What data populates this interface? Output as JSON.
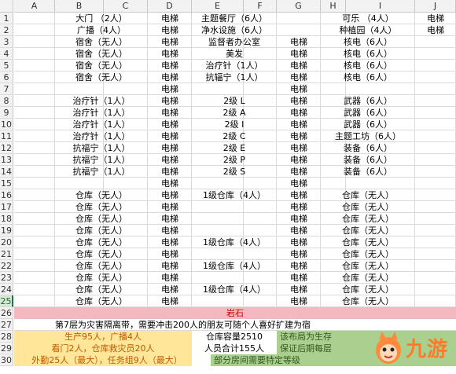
{
  "columns": [
    "A",
    "B",
    "C",
    "D",
    "E",
    "F",
    "G",
    "H",
    "I",
    "J"
  ],
  "row_numbers": [
    "1",
    "2",
    "3",
    "4",
    "5",
    "6",
    "7",
    "8",
    "9",
    "10",
    "11",
    "12",
    "13",
    "14",
    "15",
    "16",
    "17",
    "18",
    "19",
    "20",
    "21",
    "22",
    "23",
    "24",
    "25",
    "26",
    "27",
    "28",
    "29",
    "30"
  ],
  "selected_row": "25",
  "rows": [
    {
      "b": "大门  （2人）",
      "d": "电梯",
      "e": "主题餐厅（6人）",
      "g": "",
      "h": "可乐  （4人）",
      "j": "电梯"
    },
    {
      "b": "广播（4人）",
      "d": "电梯",
      "e": "净水设施（6人）",
      "g": "",
      "h": "种植园（4人）",
      "j": "电梯"
    },
    {
      "b": "宿舍（无人）",
      "d": "电梯",
      "e": "监督者办公室",
      "g": "电梯",
      "h": "核电（6人）",
      "j": ""
    },
    {
      "b": "宿舍（无人）",
      "d": "电梯",
      "e": "美发",
      "g": "电梯",
      "h": "核电（6人）",
      "j": ""
    },
    {
      "b": "宿舍（无人）",
      "d": "电梯",
      "e": "治疗针（1人）",
      "g": "电梯",
      "h": "核电（6人）",
      "j": ""
    },
    {
      "b": "宿舍（无人）",
      "d": "电梯",
      "e": "抗辐宁（1人）",
      "g": "电梯",
      "h": "核电（6人）",
      "j": ""
    },
    {
      "b": "",
      "d": "电梯",
      "e": "",
      "g": "电梯",
      "h": "",
      "j": ""
    },
    {
      "b": "治疗针（1人）",
      "d": "电梯",
      "e": "2级 L",
      "g": "电梯",
      "h": "武器（6人）",
      "j": ""
    },
    {
      "b": "治疗针（1人）",
      "d": "电梯",
      "e": "2级 A",
      "g": "电梯",
      "h": "武器（6人）",
      "j": ""
    },
    {
      "b": "治疗针（1人）",
      "d": "电梯",
      "e": "2级 I",
      "g": "电梯",
      "h": "武器（6人）",
      "j": ""
    },
    {
      "b": "治疗针（1人）",
      "d": "电梯",
      "e": "2级 C",
      "g": "电梯",
      "h": "主题工坊（6人）",
      "j": ""
    },
    {
      "b": "抗福宁（1人）",
      "d": "电梯",
      "e": "2级 E",
      "g": "电梯",
      "h": "装备（6人）",
      "j": ""
    },
    {
      "b": "抗福宁（1人）",
      "d": "电梯",
      "e": "2级 P",
      "g": "电梯",
      "h": "装备（6人）",
      "j": ""
    },
    {
      "b": "抗福宁（1人）",
      "d": "电梯",
      "e": "2级 S",
      "g": "电梯",
      "h": "装备（6人）",
      "j": ""
    },
    {
      "b": "",
      "d": "电梯",
      "e": "",
      "g": "电梯",
      "h": "",
      "j": ""
    },
    {
      "b": "仓库（无人）",
      "d": "电梯",
      "e": "1级仓库（4人）",
      "g": "电梯",
      "h": "仓库（无人）",
      "j": ""
    },
    {
      "b": "仓库（无人）",
      "d": "电梯",
      "e": "",
      "g": "电梯",
      "h": "仓库（无人）",
      "j": ""
    },
    {
      "b": "仓库（无人）",
      "d": "电梯",
      "e": "",
      "g": "电梯",
      "h": "仓库（无人）",
      "j": ""
    },
    {
      "b": "仓库（无人）",
      "d": "电梯",
      "e": "",
      "g": "电梯",
      "h": "仓库（无人）",
      "j": ""
    },
    {
      "b": "仓库（无人）",
      "d": "电梯",
      "e": "1级仓库（4人）",
      "g": "电梯",
      "h": "仓库（无人）",
      "j": ""
    },
    {
      "b": "仓库（无人）",
      "d": "电梯",
      "e": "",
      "g": "电梯",
      "h": "仓库（无人）",
      "j": ""
    },
    {
      "b": "仓库（无人）",
      "d": "电梯",
      "e": "1级仓库（4人）",
      "g": "电梯",
      "h": "仓库（无人）",
      "j": ""
    },
    {
      "b": "仓库（无人）",
      "d": "电梯",
      "e": "",
      "g": "电梯",
      "h": "仓库（无人）",
      "j": ""
    },
    {
      "b": "仓库（无人）",
      "d": "电梯",
      "e": "1级仓库（4人）",
      "g": "电梯",
      "h": "仓库（无人）",
      "j": ""
    },
    {
      "b": "仓库（无人）",
      "d": "电梯",
      "e": "",
      "g": "电梯",
      "h": "仓库（无人）",
      "j": ""
    }
  ],
  "row26": "岩石",
  "row27": "第7层为灾害隔离带，需要冲击200人的朋友可随个人喜好扩建为宿",
  "row28": {
    "left": "生产95人，广播4人",
    "mid": "仓库容量2510",
    "right": "该布局为生存"
  },
  "row29": {
    "left": "看门2人，仓库救灾员20人",
    "mid": "人员合计155人",
    "right": "保证后期每层"
  },
  "row30": {
    "left": "外勤25人（最大），任务组9人（最大）",
    "right": "部分房间需要特定等级"
  },
  "watermark": "九游",
  "colors": {
    "rock": "#f4b8c0",
    "yellow": "#ffe699",
    "green": "#a9d08e",
    "rock_text": "#c00000"
  }
}
